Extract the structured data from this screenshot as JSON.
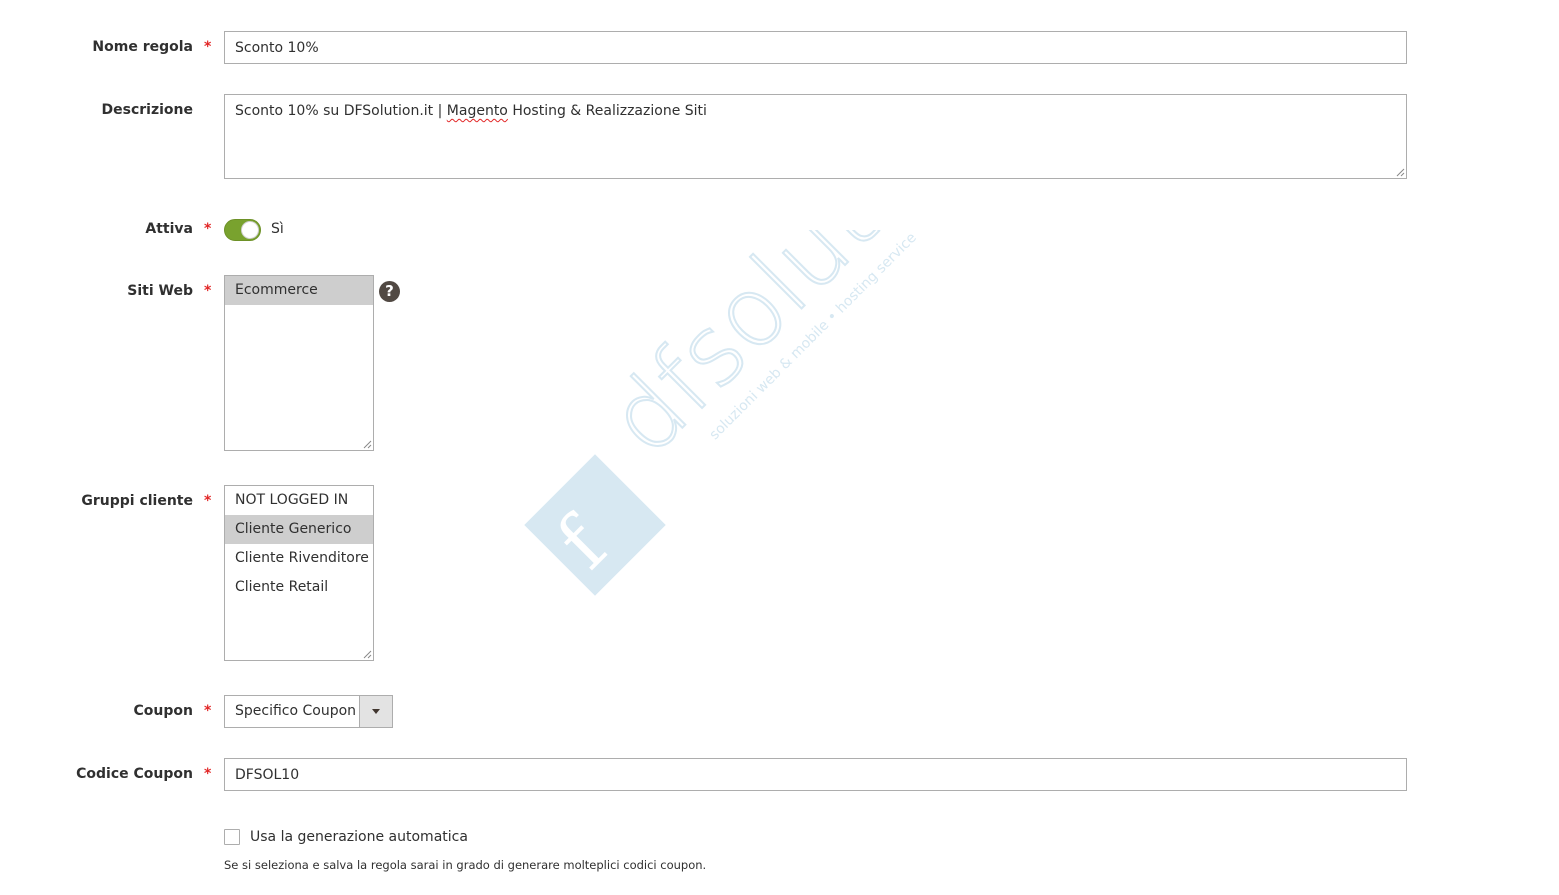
{
  "form": {
    "rule_name": {
      "label": "Nome regola",
      "value": "Sconto 10%"
    },
    "description": {
      "label": "Descrizione",
      "value_before": "Sconto 10% su DFSolution.it | ",
      "value_spell": "Magento",
      "value_after": " Hosting & Realizzazione Siti"
    },
    "active": {
      "label": "Attiva",
      "state_label": "Sì",
      "checked": true
    },
    "websites": {
      "label": "Siti Web",
      "options": [
        "Ecommerce"
      ],
      "selected": [
        "Ecommerce"
      ],
      "help_glyph": "?"
    },
    "customer_groups": {
      "label": "Gruppi cliente",
      "options": [
        "NOT LOGGED IN",
        "Cliente Generico",
        "Cliente Rivenditore",
        "Cliente Retail"
      ],
      "selected": [
        "Cliente Generico"
      ]
    },
    "coupon": {
      "label": "Coupon",
      "value": "Specifico Coupon"
    },
    "coupon_code": {
      "label": "Codice Coupon",
      "value": "DFSOL10"
    },
    "auto_generation": {
      "label": "Usa la generazione automatica",
      "checked": false,
      "note": "Se si seleziona e salva la regola sarai in grado di generare molteplici codici coupon."
    },
    "required_marker": "*"
  },
  "watermark": {
    "brand": "dfsolution",
    "tagline": "soluzioni web & mobile • hosting service",
    "color": "#d7e8f2"
  },
  "colors": {
    "toggle_on": "#79a22e",
    "required": "#e22626",
    "selected_option": "#cecece",
    "help_icon": "#514943"
  },
  "icons": {
    "help": "question-circle-icon",
    "dropdown": "caret-down-icon",
    "resize": "resize-grip-icon"
  }
}
